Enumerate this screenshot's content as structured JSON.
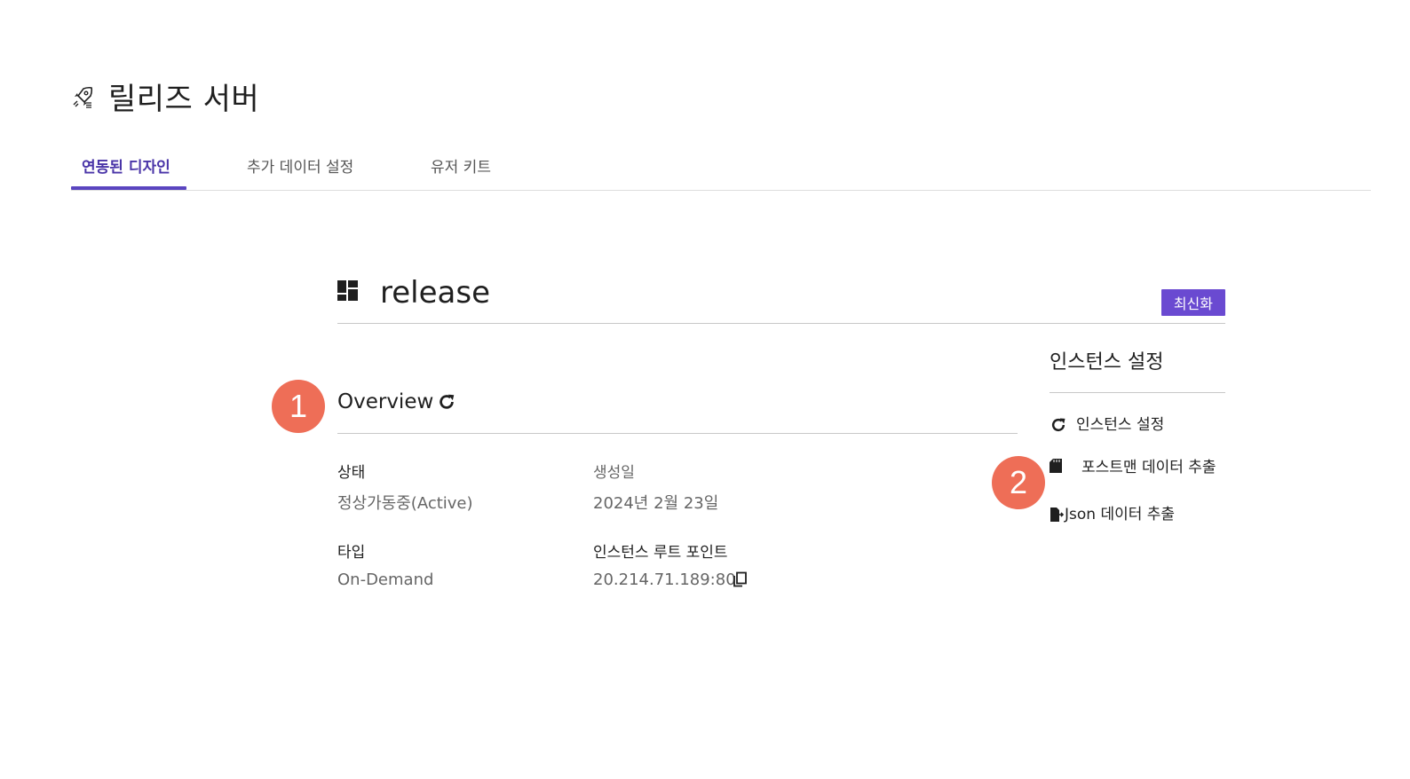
{
  "header": {
    "icon": "rocket-icon",
    "title": "릴리즈 서버"
  },
  "tabs": [
    {
      "label": "연동된 디자인",
      "active": true
    },
    {
      "label": "추가 데이터 설정",
      "active": false
    },
    {
      "label": "유저 키트",
      "active": false
    }
  ],
  "release": {
    "icon": "dashboard-icon",
    "title": "release",
    "refresh_label": "최신화"
  },
  "steps": [
    "1",
    "2"
  ],
  "overview": {
    "title": "Overview",
    "refresh_icon": "refresh-icon",
    "status_label": "상태",
    "status_value": "정상가동중(Active)",
    "created_label": "생성일",
    "created_value": "2024년 2월 23일",
    "type_label": "타입",
    "type_value": "On-Demand",
    "endpoint_label": "인스턴스 루트 포인트",
    "endpoint_value": "20.214.71.189:80",
    "copy_icon": "copy-icon"
  },
  "instance_settings": {
    "title": "인스턴스 설정",
    "items": [
      {
        "label": "인스턴스 설정",
        "icon": "refresh-icon"
      },
      {
        "label": "포스트맨 데이터 추출",
        "icon": "sd-card-icon"
      },
      {
        "label": "Json 데이터 추출",
        "icon": "file-export-icon"
      }
    ]
  },
  "colors": {
    "accent": "#5a45c0",
    "badge": "#6a4ad1",
    "step_marker": "#ee6e57"
  }
}
